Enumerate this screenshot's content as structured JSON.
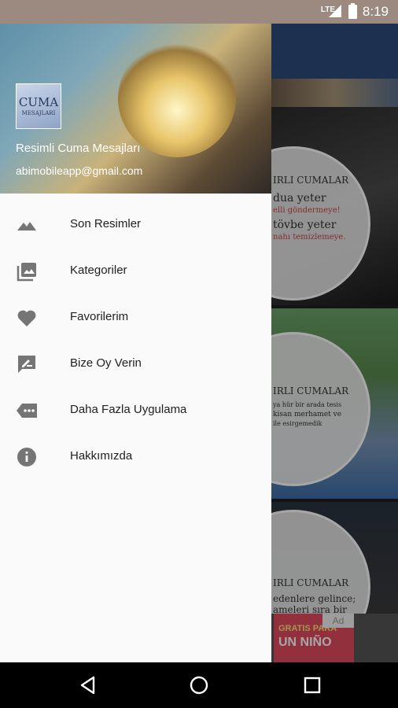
{
  "status_bar": {
    "network": "LTE",
    "time": "8:19"
  },
  "drawer": {
    "header": {
      "logo_line1": "CUMA",
      "logo_line2": "MESAJLARI",
      "app_name": "Resimli Cuma Mesajları",
      "email": "abimobileapp@gmail.com"
    },
    "items": [
      {
        "label": "Son Resimler",
        "icon": "landscape-icon"
      },
      {
        "label": "Kategoriler",
        "icon": "photo-library-icon"
      },
      {
        "label": "Favorilerim",
        "icon": "heart-icon"
      },
      {
        "label": "Bize Oy Verin",
        "icon": "rate-review-icon"
      },
      {
        "label": "Daha Fazla Uygulama",
        "icon": "more-apps-icon"
      },
      {
        "label": "Hakkımızda",
        "icon": "info-icon"
      }
    ]
  },
  "background": {
    "card1": {
      "l1": "IRLI CUMALAR",
      "l2": "dua  yeter",
      "l3": "elli göndermeye!",
      "l4": "tövbe yeter",
      "l5": "nahı temizlemeye."
    },
    "card2": {
      "l1": "IRLI CUMALAR",
      "l2": "ya hür bir arada tesis",
      "l3": "kisan merhamet ve",
      "l4": "ile esirgemedik"
    },
    "card3": {
      "l1": "IRLI CUMALAR",
      "l2": "edenlere gelince;",
      "l3": "ameleri sıra bir"
    },
    "ad": {
      "badge": "Ad",
      "line1": "GRATIS PARA",
      "line2": "UN NIÑO"
    }
  }
}
